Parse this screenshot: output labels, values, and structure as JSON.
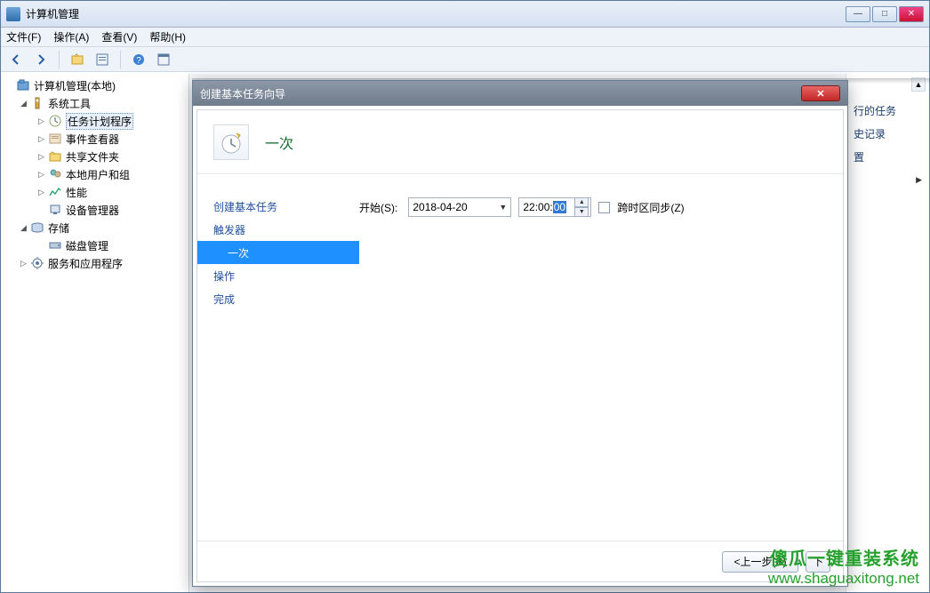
{
  "window": {
    "title": "计算机管理",
    "menus": {
      "file": "文件(F)",
      "action": "操作(A)",
      "view": "查看(V)",
      "help": "帮助(H)"
    }
  },
  "tree": {
    "root": "计算机管理(本地)",
    "systools": "系统工具",
    "tasksched": "任务计划程序",
    "eventviewer": "事件查看器",
    "shared": "共享文件夹",
    "users": "本地用户和组",
    "perf": "性能",
    "devmgr": "设备管理器",
    "storage": "存储",
    "diskmgmt": "磁盘管理",
    "services": "服务和应用程序"
  },
  "actions_panel": {
    "running_tasks": "行的任务",
    "history": "史记录",
    "settings": "置"
  },
  "dialog": {
    "title": "创建基本任务向导",
    "header_title": "一次",
    "nav": {
      "create": "创建基本任务",
      "trigger": "触发器",
      "once": "一次",
      "action": "操作",
      "finish": "完成"
    },
    "page": {
      "start_label": "开始(S):",
      "date_value": "2018-04-20",
      "time_hhmm": "22:00:",
      "time_ss": "00",
      "sync_label": "跨时区同步(Z)"
    },
    "footer": {
      "back": "<上一步(B)",
      "next_partial": "下"
    }
  },
  "watermark": {
    "line1": "傻瓜一键重装系统",
    "line2": "www.shaguaxitong.net"
  }
}
